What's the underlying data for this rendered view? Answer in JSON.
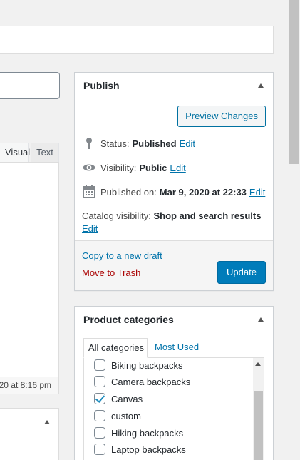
{
  "editor": {
    "tabs": {
      "visual": "Visual",
      "text": "Text"
    },
    "status_text": "20 at 8:16 pm"
  },
  "publish": {
    "title": "Publish",
    "preview_label": "Preview Changes",
    "status_label": "Status:",
    "status_value": "Published",
    "visibility_label": "Visibility:",
    "visibility_value": "Public",
    "published_label": "Published on:",
    "published_value": "Mar 9, 2020 at 22:33",
    "catalog_label": "Catalog visibility:",
    "catalog_value": "Shop and search results",
    "edit_label": "Edit",
    "copy_draft_label": "Copy to a new draft",
    "trash_label": "Move to Trash",
    "update_label": "Update"
  },
  "categories": {
    "title": "Product categories",
    "tab_all": "All categories",
    "tab_most_used": "Most Used",
    "items": [
      {
        "label": "Biking backpacks",
        "checked": false
      },
      {
        "label": "Camera backpacks",
        "checked": false
      },
      {
        "label": "Canvas",
        "checked": true
      },
      {
        "label": "custom",
        "checked": false
      },
      {
        "label": "Hiking backpacks",
        "checked": false
      },
      {
        "label": "Laptop backpacks",
        "checked": false
      }
    ]
  },
  "colors": {
    "link": "#0073aa",
    "primary_button": "#007cba",
    "trash": "#a00000"
  },
  "icons": {
    "status": "pin-icon",
    "visibility": "eye-icon",
    "published": "calendar-icon"
  }
}
